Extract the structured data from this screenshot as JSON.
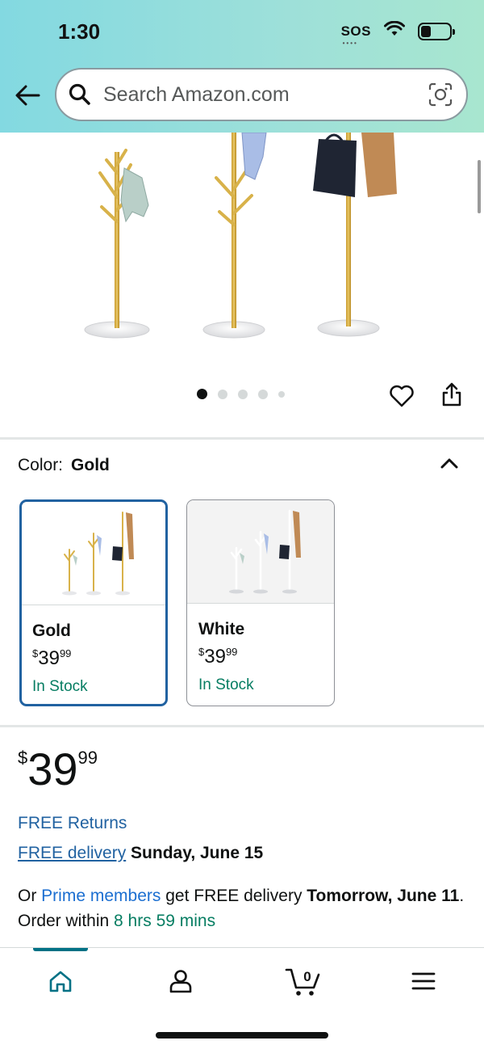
{
  "status_bar": {
    "time": "1:30",
    "sos": "SOS"
  },
  "search": {
    "placeholder": "Search Amazon.com"
  },
  "gallery": {
    "image_count": 5,
    "active_index": 0
  },
  "color_selector": {
    "label": "Color:",
    "selected": "Gold",
    "options": [
      {
        "name": "Gold",
        "price_symbol": "$",
        "price_whole": "39",
        "price_fraction": "99",
        "stock": "In Stock",
        "selected": true
      },
      {
        "name": "White",
        "price_symbol": "$",
        "price_whole": "39",
        "price_fraction": "99",
        "stock": "In Stock",
        "selected": false
      }
    ]
  },
  "price": {
    "symbol": "$",
    "whole": "39",
    "fraction": "99"
  },
  "free_returns": "FREE Returns",
  "delivery": {
    "link": "FREE delivery",
    "date": "Sunday, June 15"
  },
  "prime_offer": {
    "prefix": "Or ",
    "link": "Prime members",
    "middle": " get FREE delivery ",
    "day": "Tomorrow, June 11",
    "after": ". Order within ",
    "countdown": "8 hrs 59 mins"
  },
  "bottom_nav": {
    "items": [
      {
        "icon": "home-icon",
        "active": true
      },
      {
        "icon": "account-icon",
        "active": false
      },
      {
        "icon": "cart-icon",
        "count": "0",
        "active": false
      },
      {
        "icon": "menu-icon",
        "active": false
      }
    ]
  },
  "colors": {
    "accent_blue": "#2162a1",
    "link_blue": "#1c6fd1",
    "stock_green": "#067d62",
    "nav_teal": "#007185",
    "header_gradient_start": "#83d9e1",
    "header_gradient_end": "#a8e6cf",
    "stand_gold": "#d8b24a"
  }
}
